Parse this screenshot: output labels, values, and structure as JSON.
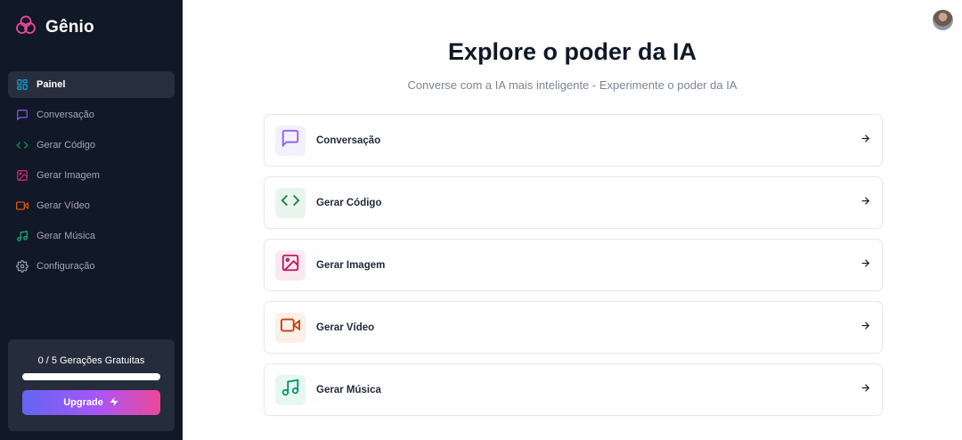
{
  "brand": {
    "name": "Gênio",
    "icon": "logo-icon"
  },
  "sidebar": {
    "items": [
      {
        "label": "Painel",
        "icon": "grid-icon",
        "color": "#0ea5e9",
        "active": true
      },
      {
        "label": "Conversação",
        "icon": "message-icon",
        "color": "#8b5cf6",
        "active": false
      },
      {
        "label": "Gerar Código",
        "icon": "code-icon",
        "color": "#16a34a",
        "active": false
      },
      {
        "label": "Gerar Imagem",
        "icon": "image-icon",
        "color": "#db2777",
        "active": false
      },
      {
        "label": "Gerar Vídeo",
        "icon": "video-icon",
        "color": "#ea580c",
        "active": false
      },
      {
        "label": "Gerar Música",
        "icon": "music-icon",
        "color": "#10b981",
        "active": false
      },
      {
        "label": "Configuração",
        "icon": "gear-icon",
        "color": "#9ca3af",
        "active": false
      }
    ]
  },
  "quota": {
    "text": "0 / 5 Gerações Gratuitas",
    "used": 0,
    "limit": 5,
    "progress": 0,
    "upgrade_label": "Upgrade"
  },
  "hero": {
    "title": "Explore o poder da IA",
    "subtitle": "Converse com a IA mais inteligente - Experimente o poder da IA"
  },
  "cards": [
    {
      "label": "Conversação",
      "icon": "message-icon",
      "color": "#8b5cf6",
      "bg": "#f3effd"
    },
    {
      "label": "Gerar Código",
      "icon": "code-icon",
      "color": "#15803d",
      "bg": "#e8f5ec"
    },
    {
      "label": "Gerar Imagem",
      "icon": "image-icon",
      "color": "#be185d",
      "bg": "#fbe9f1"
    },
    {
      "label": "Gerar Vídeo",
      "icon": "video-icon",
      "color": "#c2410c",
      "bg": "#fdf0e8"
    },
    {
      "label": "Gerar Música",
      "icon": "music-icon",
      "color": "#059669",
      "bg": "#e6f7f1"
    }
  ],
  "colors": {
    "sidebar_bg": "#111827",
    "accent_gradient": [
      "#6366f1",
      "#a855f7",
      "#ec4899"
    ]
  }
}
